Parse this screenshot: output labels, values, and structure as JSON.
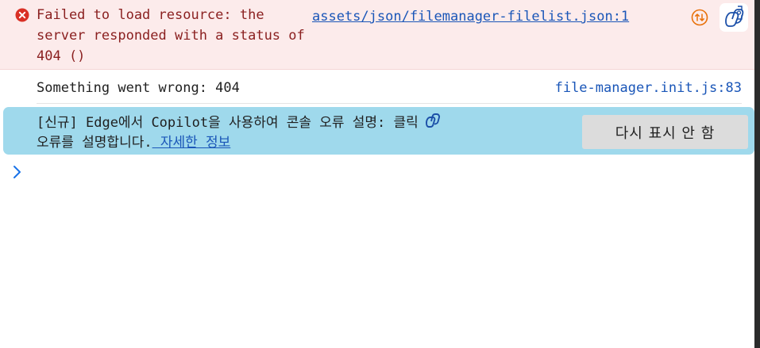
{
  "error_message": {
    "text": "Failed to load resource: the server responded with a status of 404 ()",
    "source_link": "assets/json/filemanager-filelist.json:1",
    "icons": [
      "error-circle-icon",
      "network-request-icon",
      "copilot-explain-icon"
    ]
  },
  "log_message": {
    "text": "Something went wrong: 404",
    "source_link": "file-manager.init.js:83"
  },
  "copilot_banner": {
    "line1": "[신규] Edge에서 Copilot을 사용하여 콘솔 오류 설명: 클릭",
    "line2_prefix": "오류를 설명합니다.",
    "link_text": " 자세한 정보",
    "dismiss_label": "다시 표시 안 함",
    "icon": "copilot-icon"
  },
  "console_prompt": {
    "icon": "chevron-right-icon"
  },
  "colors": {
    "error_background": "#fcebeb",
    "error_text": "#8a1f1f",
    "link": "#1a56b8",
    "banner_background": "#9fd9ec",
    "prompt": "#1a73e8"
  }
}
